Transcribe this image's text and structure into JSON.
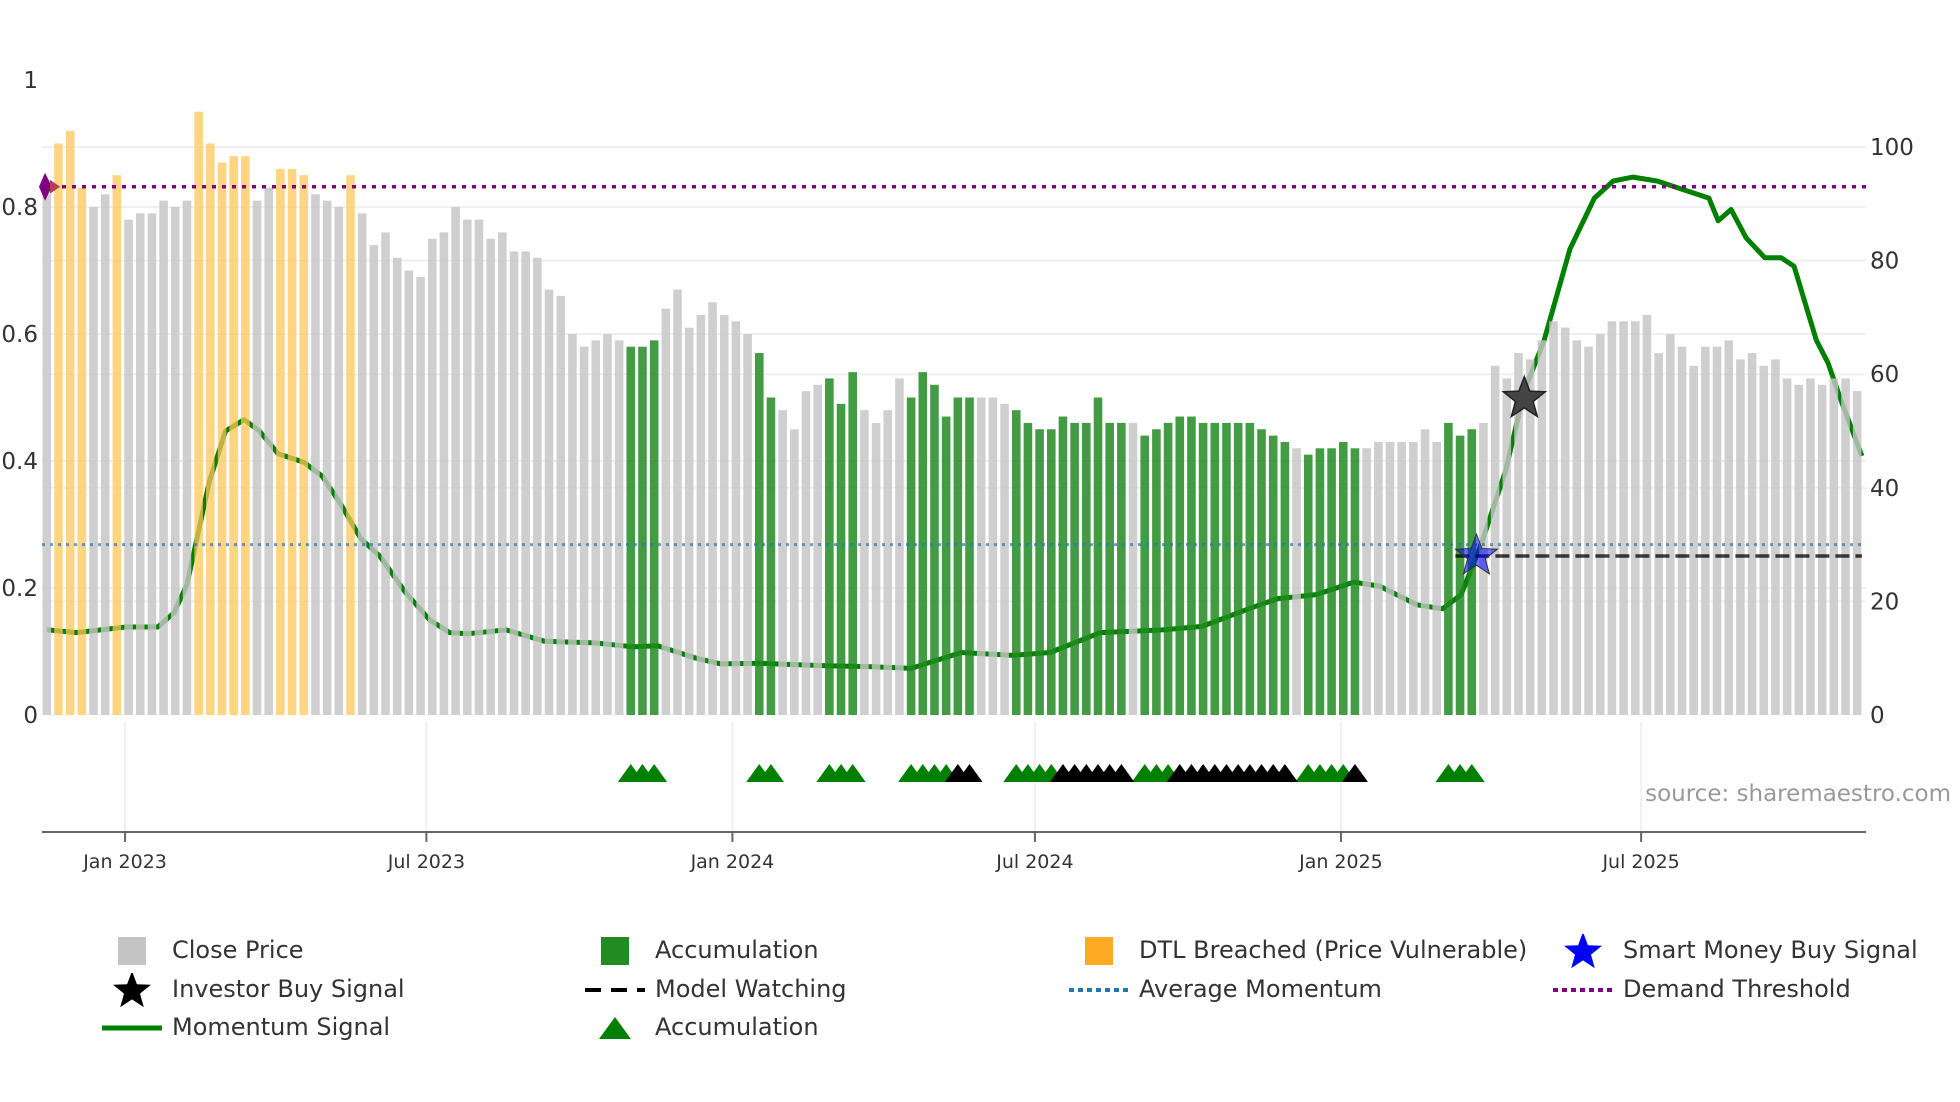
{
  "chart_data": {
    "type": "bar",
    "title": "",
    "source": "source: sharemaestro.com",
    "colors": {
      "close": "#c4c4c4",
      "accumulation": "#228b22",
      "dtl": "#ffc55a",
      "momentum": "#008000",
      "avg_momentum": "#1f77b4",
      "demand": "#800080",
      "smart_money": "#0000ff",
      "investor": "#000000",
      "watch": "#000000"
    },
    "left_axis": {
      "ticks": [
        "0",
        "0.2",
        "0.4",
        "0.6",
        "0.8",
        "1"
      ],
      "values": [
        0,
        0.2,
        0.4,
        0.6,
        0.8,
        1
      ],
      "range": [
        0,
        1
      ]
    },
    "right_axis": {
      "ticks": [
        "0",
        "20",
        "40",
        "60",
        "80",
        "100"
      ],
      "values": [
        0,
        20,
        40,
        60,
        80,
        100
      ],
      "range": [
        0,
        100
      ]
    },
    "x_axis": {
      "unit": "weeks from first bar (mid-Nov 2022)",
      "ticks": [
        {
          "label": "Jan 2023",
          "week": 6.7
        },
        {
          "label": "Jul 2023",
          "week": 32.5
        },
        {
          "label": "Jan 2024",
          "week": 58.7
        },
        {
          "label": "Jul 2024",
          "week": 84.6
        },
        {
          "label": "Jan 2025",
          "week": 110.8
        },
        {
          "label": "Jul 2025",
          "week": 136.5
        }
      ]
    },
    "close_price_normalized": [
      0.82,
      0.9,
      0.92,
      0.83,
      0.8,
      0.82,
      0.85,
      0.78,
      0.79,
      0.79,
      0.81,
      0.8,
      0.81,
      0.95,
      0.9,
      0.87,
      0.88,
      0.88,
      0.81,
      0.83,
      0.86,
      0.86,
      0.85,
      0.82,
      0.81,
      0.8,
      0.85,
      0.79,
      0.74,
      0.76,
      0.72,
      0.7,
      0.69,
      0.75,
      0.76,
      0.8,
      0.78,
      0.78,
      0.75,
      0.76,
      0.73,
      0.73,
      0.72,
      0.67,
      0.66,
      0.6,
      0.58,
      0.59,
      0.6,
      0.59,
      0.58,
      0.58,
      0.59,
      0.64,
      0.67,
      0.61,
      0.63,
      0.65,
      0.63,
      0.62,
      0.6,
      0.57,
      0.5,
      0.48,
      0.45,
      0.51,
      0.52,
      0.53,
      0.49,
      0.54,
      0.48,
      0.46,
      0.48,
      0.53,
      0.5,
      0.54,
      0.52,
      0.47,
      0.5,
      0.5,
      0.5,
      0.5,
      0.49,
      0.48,
      0.46,
      0.45,
      0.45,
      0.47,
      0.46,
      0.46,
      0.5,
      0.46,
      0.46,
      0.46,
      0.44,
      0.45,
      0.46,
      0.47,
      0.47,
      0.46,
      0.46,
      0.46,
      0.46,
      0.46,
      0.45,
      0.44,
      0.43,
      0.42,
      0.41,
      0.42,
      0.42,
      0.43,
      0.42,
      0.42,
      0.43,
      0.43,
      0.43,
      0.43,
      0.45,
      0.43,
      0.46,
      0.44,
      0.45,
      0.46,
      0.55,
      0.53,
      0.57,
      0.56,
      0.59,
      0.62,
      0.61,
      0.59,
      0.58,
      0.6,
      0.62,
      0.62,
      0.62,
      0.63,
      0.57,
      0.6,
      0.58,
      0.55,
      0.58,
      0.58,
      0.59,
      0.56,
      0.57,
      0.55,
      0.56,
      0.53,
      0.52,
      0.53,
      0.52,
      0.53,
      0.53,
      0.51
    ],
    "bar_state": "GOOOGGOGGGGGGOOOOOGGOOOGGGOGGGGGGGGGGGGGGGGGGGGGGGAAAGGGGGGGGAAGGGGAAAGGGGAAAAAAGGGAAAAAAAAAAGAAAAAAAAAAAAAGAAAAAGGGGGGGAAAGGGGGGGGGGGGGGGGGGGGGGGGGGGGGGGGG",
    "bar_state_key": {
      "G": "Close Price",
      "O": "DTL Breached (Price Vulnerable)",
      "A": "Accumulation"
    },
    "momentum": [
      [
        0,
        15
      ],
      [
        2.5,
        14.5
      ],
      [
        6.8,
        15.5
      ],
      [
        9.5,
        15.5
      ],
      [
        10.9,
        18
      ],
      [
        12,
        23
      ],
      [
        13.9,
        41
      ],
      [
        15.3,
        50
      ],
      [
        16.9,
        52
      ],
      [
        18.2,
        50
      ],
      [
        19.8,
        46
      ],
      [
        22,
        44.5
      ],
      [
        23.6,
        42
      ],
      [
        25.2,
        37
      ],
      [
        26.9,
        31
      ],
      [
        28.5,
        28
      ],
      [
        30.7,
        21.6
      ],
      [
        32.8,
        16.7
      ],
      [
        34.5,
        14.5
      ],
      [
        36,
        14.3
      ],
      [
        39.3,
        15
      ],
      [
        42.6,
        13
      ],
      [
        46.9,
        12.7
      ],
      [
        50.2,
        12
      ],
      [
        52.3,
        12.2
      ],
      [
        55.6,
        10
      ],
      [
        57.7,
        9
      ],
      [
        61,
        9.1
      ],
      [
        66.4,
        8.7
      ],
      [
        70.7,
        8.5
      ],
      [
        74,
        8.2
      ],
      [
        78.3,
        11
      ],
      [
        82.7,
        10.5
      ],
      [
        85.9,
        11
      ],
      [
        90.2,
        14.5
      ],
      [
        95.7,
        15
      ],
      [
        98.9,
        15.6
      ],
      [
        103.3,
        19
      ],
      [
        105.4,
        20.5
      ],
      [
        108.7,
        21.2
      ],
      [
        111.9,
        23.4
      ],
      [
        114.1,
        22.7
      ],
      [
        117.3,
        19.4
      ],
      [
        119.5,
        18.7
      ],
      [
        121.1,
        21.2
      ],
      [
        122.8,
        30
      ],
      [
        124.9,
        43
      ],
      [
        126.5,
        57
      ],
      [
        128.2,
        66
      ],
      [
        130.4,
        82
      ],
      [
        132.5,
        91
      ],
      [
        134.1,
        94
      ],
      [
        135.8,
        94.7
      ],
      [
        137.9,
        94
      ],
      [
        140.1,
        92.5
      ],
      [
        142.3,
        91
      ],
      [
        143.1,
        87
      ],
      [
        144.2,
        89
      ],
      [
        145.5,
        84
      ],
      [
        147.1,
        80.5
      ],
      [
        148.5,
        80.5
      ],
      [
        149.6,
        79
      ],
      [
        151.5,
        66
      ],
      [
        152.5,
        62
      ],
      [
        153.6,
        55.5
      ],
      [
        155.4,
        45.6
      ]
    ],
    "average_momentum": 30,
    "demand_threshold": 93,
    "model_watching": {
      "start_week": 120.6,
      "end_week": 155.4,
      "value": 28
    },
    "smart_money_buy": [
      {
        "week": 122.4,
        "value": 28
      }
    ],
    "investor_buy": [
      {
        "week": 126.5,
        "value": 55.7
      }
    ],
    "accumulation_markers": {
      "green": [
        50,
        51,
        52,
        61,
        62,
        67,
        68,
        69,
        74,
        75,
        76,
        77,
        83,
        84,
        85,
        86,
        94,
        95,
        96,
        108,
        109,
        110,
        111,
        120,
        121,
        122
      ],
      "black": [
        78,
        79,
        87,
        88,
        89,
        90,
        91,
        92,
        97,
        98,
        99,
        100,
        101,
        102,
        103,
        104,
        105,
        106,
        112
      ]
    },
    "legend": [
      {
        "label": "Close Price",
        "icon": "gray-square"
      },
      {
        "label": "Accumulation",
        "icon": "green-square"
      },
      {
        "label": "DTL Breached (Price Vulnerable)",
        "icon": "orange-square"
      },
      {
        "label": "Smart Money Buy Signal",
        "icon": "blue-star"
      },
      {
        "label": "Investor Buy Signal",
        "icon": "black-star"
      },
      {
        "label": "Model Watching",
        "icon": "black-dashed-line"
      },
      {
        "label": "Average Momentum",
        "icon": "blue-dotted-line"
      },
      {
        "label": "Demand Threshold",
        "icon": "purple-dotted-line"
      },
      {
        "label": "Momentum Signal",
        "icon": "green-line"
      },
      {
        "label": "Accumulation",
        "icon": "green-triangle"
      }
    ]
  }
}
